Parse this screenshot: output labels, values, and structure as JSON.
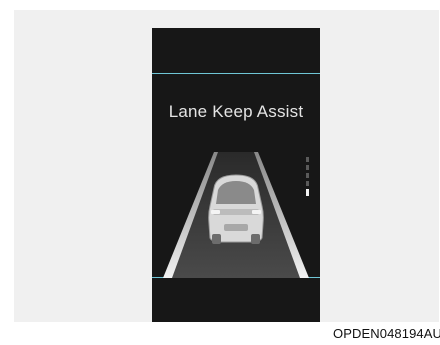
{
  "display": {
    "title": "Lane Keep Assist",
    "accent_color": "#6fc6d6",
    "background_color": "#171717",
    "lane_icons": [
      "left-lane-line",
      "right-lane-line",
      "vehicle-rear-view"
    ]
  },
  "caption": {
    "code": "OPDEN048194AU"
  }
}
